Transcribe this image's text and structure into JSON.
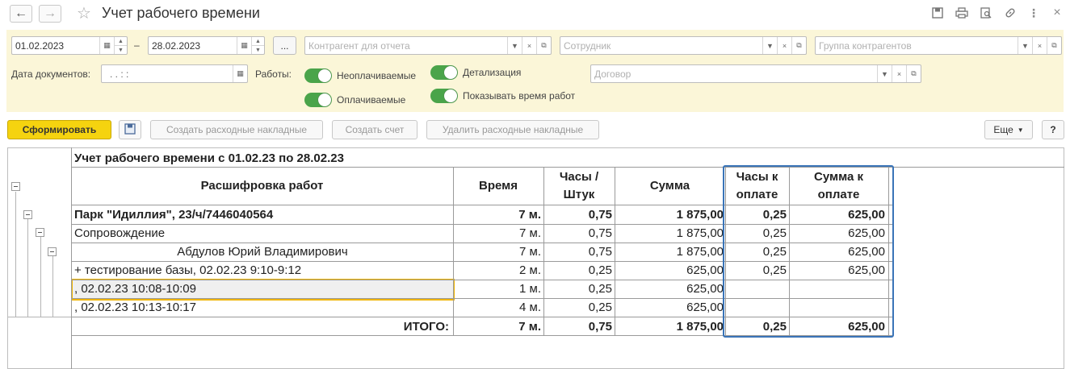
{
  "window": {
    "title": "Учет рабочего времени",
    "icons": [
      "back-arrow-icon",
      "forward-arrow-icon",
      "star-icon",
      "save-icon",
      "print-icon",
      "preview-icon",
      "link-icon",
      "more-vert-icon",
      "close-icon"
    ]
  },
  "filters": {
    "date_from": "01.02.2023",
    "dash": "–",
    "date_to": "28.02.2023",
    "dots_label": "...",
    "counterparty_placeholder": "Контрагент для отчета",
    "employee_placeholder": "Сотрудник",
    "group_placeholder": "Группа контрагентов",
    "doc_date_label": "Дата документов:",
    "doc_date_value": ".  .      :  :",
    "works_label": "Работы:",
    "toggle_unpaid": "Неоплачиваемые",
    "toggle_paid": "Оплачиваемые",
    "toggle_detail": "Детализация",
    "toggle_show_time": "Показывать время работ",
    "contract_placeholder": "Договор"
  },
  "toolbar": {
    "generate": "Сформировать",
    "create_invoices": "Создать расходные накладные",
    "create_bill": "Создать счет",
    "delete_invoices": "Удалить расходные накладные",
    "more": "Еще",
    "help": "?"
  },
  "report": {
    "title": "Учет рабочего времени с 01.02.23 по 28.02.23",
    "headers": {
      "desc": "Расшифровка работ",
      "time": "Время",
      "hours_l1": "Часы /",
      "hours_l2": "Штук",
      "sum": "Сумма",
      "pay_hours_l1": "Часы к",
      "pay_hours_l2": "оплате",
      "pay_sum_l1": "Сумма к",
      "pay_sum_l2": "оплате"
    },
    "rows": [
      {
        "desc": "Парк \"Идиллия\", 23/ч/7446040564",
        "time": "7 м.",
        "hours": "0,75",
        "sum": "1 875,00",
        "pay_hours": "0,25",
        "pay_sum": "625,00"
      },
      {
        "desc": "Сопровождение",
        "time": "7 м.",
        "hours": "0,75",
        "sum": "1 875,00",
        "pay_hours": "0,25",
        "pay_sum": "625,00"
      },
      {
        "desc": "Абдулов Юрий Владимирович",
        "time": "7 м.",
        "hours": "0,75",
        "sum": "1 875,00",
        "pay_hours": "0,25",
        "pay_sum": "625,00"
      },
      {
        "desc": "+ тестирование базы,  02.02.23 9:10-9:12",
        "time": "2 м.",
        "hours": "0,25",
        "sum": "625,00",
        "pay_hours": "0,25",
        "pay_sum": "625,00"
      },
      {
        "desc": ",  02.02.23 10:08-10:09",
        "time": "1 м.",
        "hours": "0,25",
        "sum": "625,00",
        "pay_hours": "",
        "pay_sum": ""
      },
      {
        "desc": ",  02.02.23 10:13-10:17",
        "time": "4 м.",
        "hours": "0,25",
        "sum": "625,00",
        "pay_hours": "",
        "pay_sum": ""
      }
    ],
    "total": {
      "label": "ИТОГО:",
      "time": "7 м.",
      "hours": "0,75",
      "sum": "1 875,00",
      "pay_hours": "0,25",
      "pay_sum": "625,00"
    }
  }
}
